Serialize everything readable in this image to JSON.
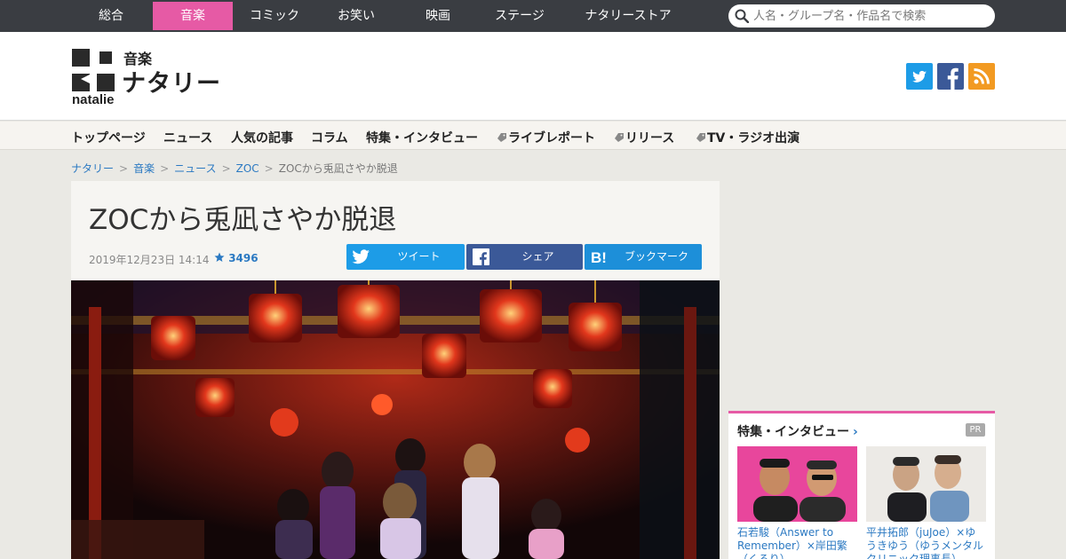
{
  "genres": [
    {
      "label": "総合",
      "active": false
    },
    {
      "label": "音楽",
      "active": true
    },
    {
      "label": "コミック",
      "active": false
    },
    {
      "label": "お笑い",
      "active": false
    },
    {
      "label": "映画",
      "active": false
    },
    {
      "label": "ステージ",
      "active": false
    },
    {
      "label": "ナタリーストア",
      "active": false
    }
  ],
  "search": {
    "placeholder": "人名・グループ名・作品名で検索",
    "icon": "search-icon"
  },
  "logo": {
    "genre": "音楽",
    "name": "ナタリー",
    "latin": "natalie"
  },
  "social": {
    "twitter_icon": "twitter-icon",
    "facebook_icon": "facebook-icon",
    "rss_icon": "rss-icon"
  },
  "subnav": [
    "トップページ",
    "ニュース",
    "人気の記事",
    "コラム",
    "特集・インタビュー",
    "ライブレポート",
    "リリース",
    "TV・ラジオ出演"
  ],
  "breadcrumb": {
    "links": [
      "ナタリー",
      "音楽",
      "ニュース",
      "ZOC"
    ],
    "current": "ZOCから兎凪さやか脱退"
  },
  "article": {
    "title": "ZOCから兎凪さやか脱退",
    "date": "2019年12月23日 14:14",
    "favorites": "3496",
    "share": {
      "tweet": "ツイート",
      "share": "シェア",
      "bookmark": "ブックマーク"
    }
  },
  "sidebar": {
    "title": "特集・インタビュー",
    "chevron": "›",
    "badge": "PR",
    "cards": [
      {
        "caption": "石若駿（Answer to Remember）×岸田繁（くるり）"
      },
      {
        "caption": "平井拓郎（juJoe）×ゆうきゆう（ゆうメンタルクリニック理事長）"
      }
    ]
  },
  "colors": {
    "accent": "#e65aa5",
    "topbar": "#3a3d42",
    "link": "#2b79c2",
    "twitter": "#1d9ce7",
    "facebook": "#3b5998",
    "hatena": "#1d8fd9",
    "rss": "#f29a22"
  }
}
